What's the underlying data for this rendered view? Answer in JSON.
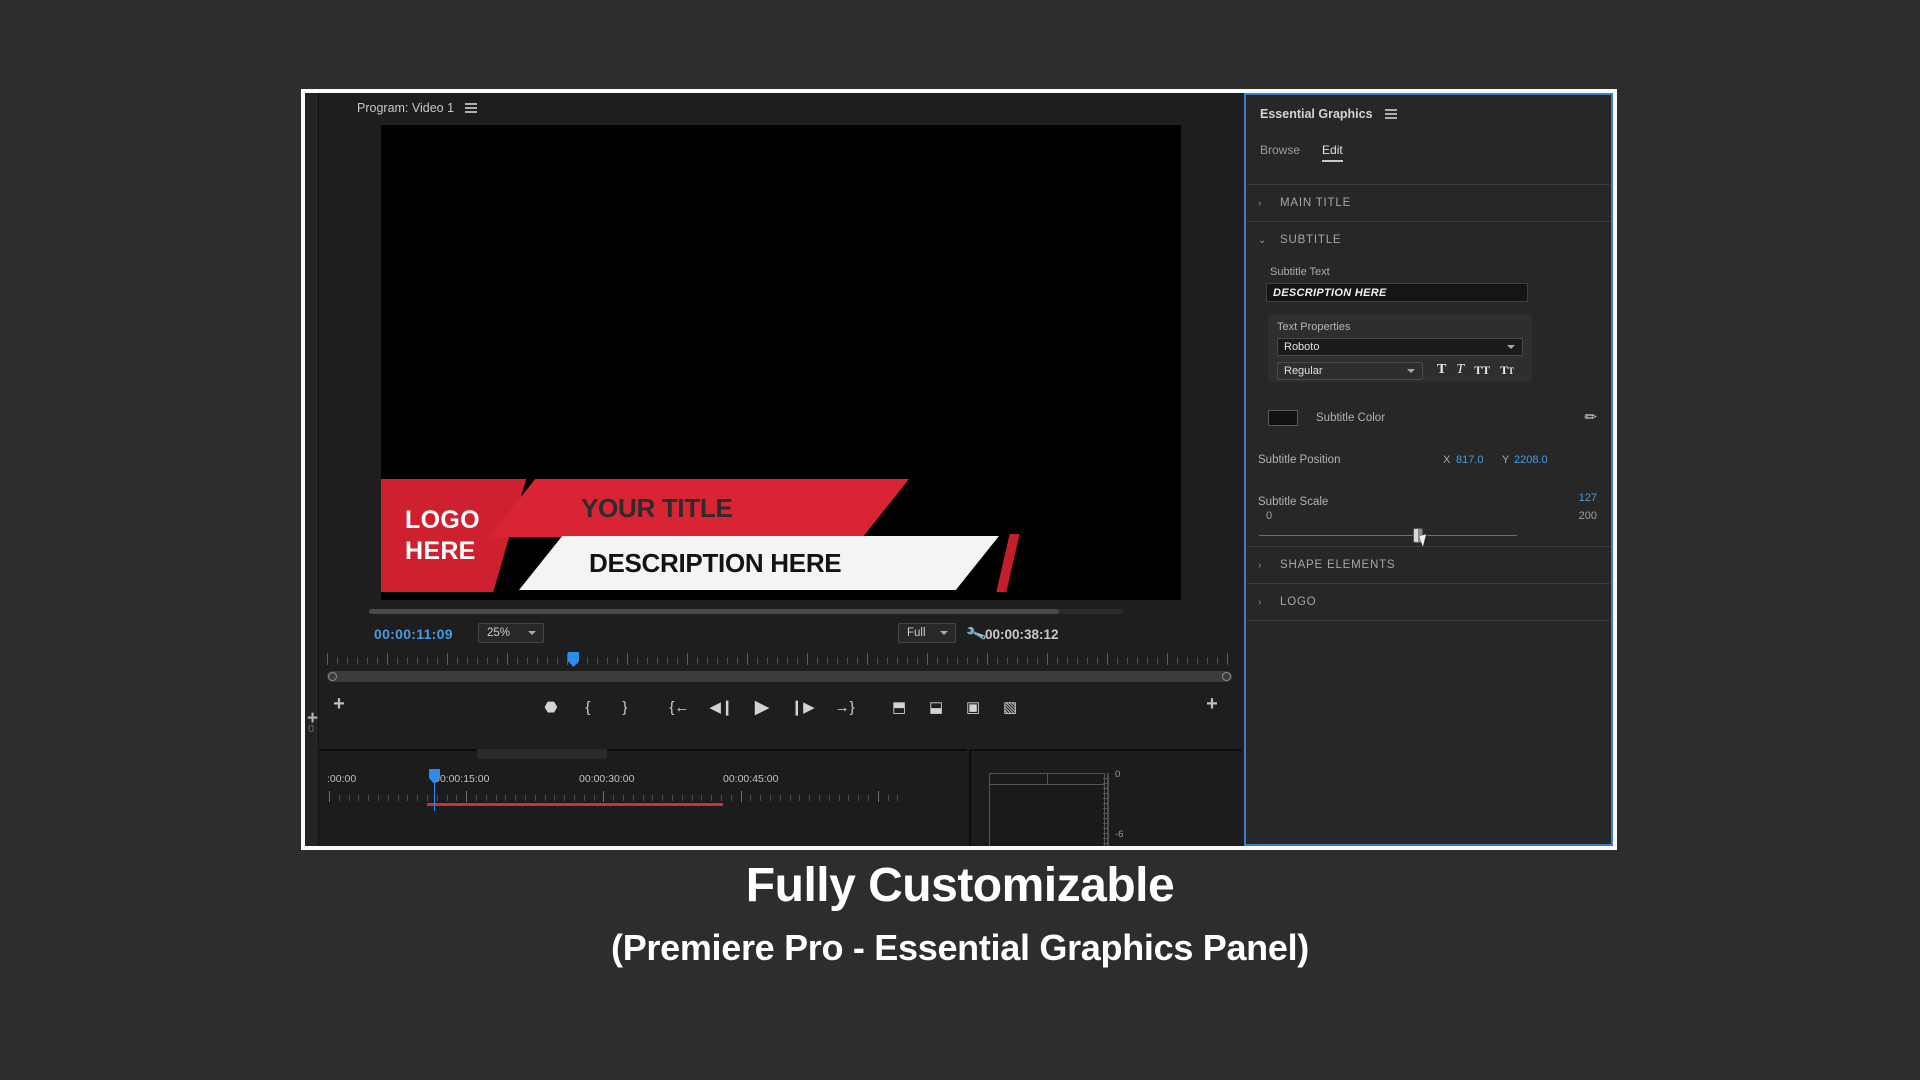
{
  "app": {
    "window_border_color": "#fafafa",
    "background_color": "#2d2d2d"
  },
  "program_monitor": {
    "title": "Program: Video 1",
    "menu_icon": "hamburger-icon",
    "current_timecode": "00:00:11:09",
    "duration_timecode": "00:00:38:12",
    "zoom_level": "25%",
    "resolution": "Full",
    "settings_icon": "wrench-icon",
    "lower_third": {
      "logo_line1": "LOGO",
      "logo_line2": "HERE",
      "title": "YOUR TITLE",
      "description": "DESCRIPTION HERE",
      "red": "#d22030",
      "white": "#f4f4f2"
    },
    "transport_buttons": [
      {
        "name": "add-marker-button",
        "glyph": "⬣"
      },
      {
        "name": "mark-in-button",
        "glyph": "{"
      },
      {
        "name": "mark-out-button",
        "glyph": "}"
      },
      {
        "name": "go-to-in-button",
        "glyph": "{←"
      },
      {
        "name": "step-back-button",
        "glyph": "◀❙"
      },
      {
        "name": "play-stop-button",
        "glyph": "▶"
      },
      {
        "name": "step-forward-button",
        "glyph": "❙▶"
      },
      {
        "name": "go-to-out-button",
        "glyph": "→}"
      },
      {
        "name": "lift-button",
        "glyph": "⬒"
      },
      {
        "name": "extract-button",
        "glyph": "⬓"
      },
      {
        "name": "export-frame-button",
        "glyph": "▣"
      },
      {
        "name": "comparison-view-button",
        "glyph": "▧"
      }
    ],
    "button_editor_left": "+",
    "button_editor_right": "+"
  },
  "timeline": {
    "ruler_labels": [
      ":00:00",
      "00:00:15:00",
      "00:00:30:00",
      "00:00:45:00"
    ],
    "clip_color": "#c9303d",
    "playhead_color": "#2d8ceb"
  },
  "audio_meter": {
    "scale_labels": [
      "0",
      "-6"
    ]
  },
  "essential_graphics": {
    "panel_title": "Essential Graphics",
    "menu_icon": "hamburger-icon",
    "accent_color": "#3b7ec9",
    "tabs": [
      {
        "label": "Browse",
        "active": false
      },
      {
        "label": "Edit",
        "active": true
      }
    ],
    "sections": [
      {
        "name": "MAIN TITLE",
        "expanded": false,
        "arrow": "›"
      },
      {
        "name": "SUBTITLE",
        "expanded": true,
        "arrow": "⌄"
      },
      {
        "name": "SHAPE ELEMENTS",
        "expanded": false,
        "arrow": "›"
      },
      {
        "name": "LOGO",
        "expanded": false,
        "arrow": "›"
      }
    ],
    "subtitle": {
      "text_label": "Subtitle Text",
      "text_value": "DESCRIPTION HERE",
      "text_properties_label": "Text Properties",
      "font_family": "Roboto",
      "font_style": "Regular",
      "format_buttons": [
        {
          "name": "bold-button",
          "glyph": "T"
        },
        {
          "name": "italic-button",
          "glyph": "T"
        },
        {
          "name": "all-caps-button",
          "glyph": "TT"
        },
        {
          "name": "small-caps-button",
          "glyph": "T"
        }
      ],
      "color_label": "Subtitle Color",
      "color_value": "#111111",
      "eyedropper_icon": "eyedropper-icon",
      "position_label": "Subtitle Position",
      "position_x_axis": "X",
      "position_x_value": "817.0",
      "position_y_axis": "Y",
      "position_y_value": "2208.0",
      "scale_label": "Subtitle Scale",
      "scale_value": "127",
      "scale_min": "0",
      "scale_max": "200"
    }
  },
  "caption": {
    "line1": "Fully Customizable",
    "line2": "(Premiere Pro - Essential Graphics Panel)"
  }
}
